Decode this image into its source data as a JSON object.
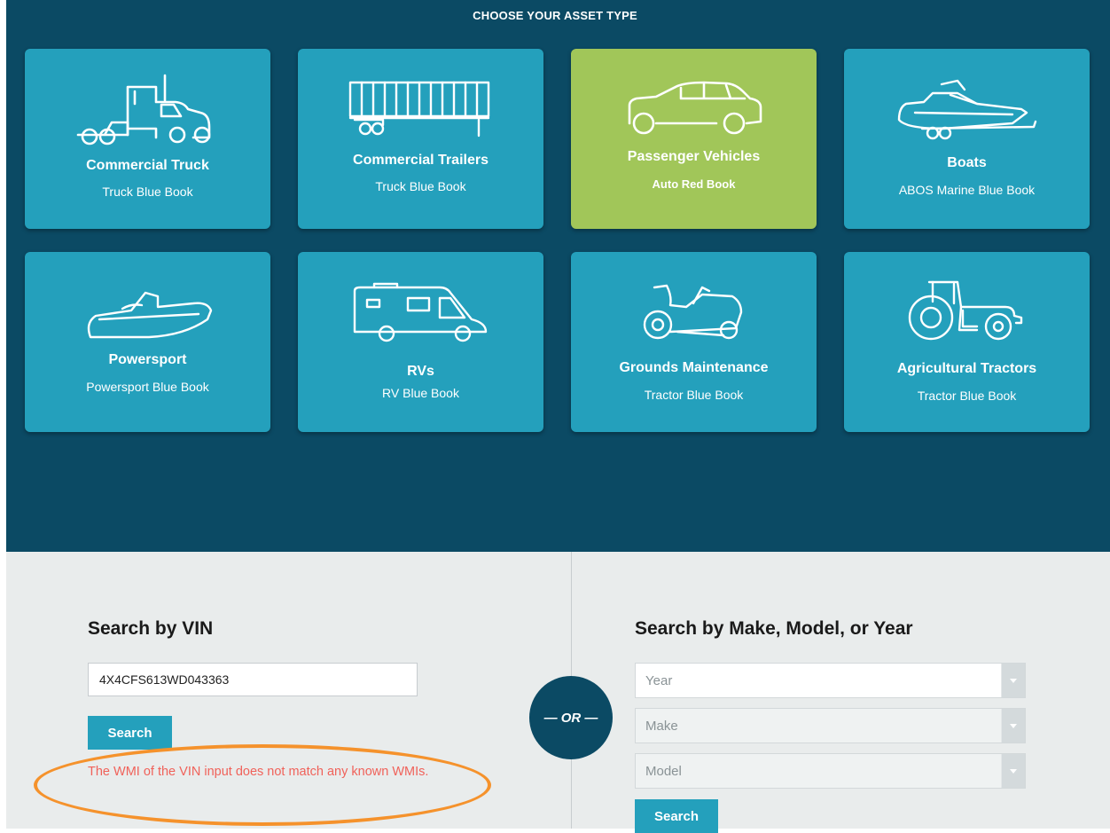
{
  "hero": {
    "title": "CHOOSE YOUR ASSET TYPE"
  },
  "tiles": [
    {
      "title": "Commercial Truck",
      "subtitle": "Truck Blue Book",
      "icon": "truck-icon",
      "selected": false
    },
    {
      "title": "Commercial Trailers",
      "subtitle": "Truck Blue Book",
      "icon": "trailer-icon",
      "selected": false
    },
    {
      "title": "Passenger Vehicles",
      "subtitle": "Auto Red Book",
      "icon": "car-icon",
      "selected": true
    },
    {
      "title": "Boats",
      "subtitle": "ABOS Marine Blue Book",
      "icon": "boat-icon",
      "selected": false
    },
    {
      "title": "Powersport",
      "subtitle": "Powersport Blue Book",
      "icon": "jetski-icon",
      "selected": false
    },
    {
      "title": "RVs",
      "subtitle": "RV Blue Book",
      "icon": "rv-icon",
      "selected": false
    },
    {
      "title": "Grounds Maintenance",
      "subtitle": "Tractor Blue Book",
      "icon": "riding-mower-icon",
      "selected": false
    },
    {
      "title": "Agricultural Tractors",
      "subtitle": "Tractor Blue Book",
      "icon": "tractor-icon",
      "selected": false
    }
  ],
  "vin_search": {
    "title": "Search by VIN",
    "input_value": "4X4CFS613WD043363",
    "button_label": "Search",
    "error": "The WMI of the VIN input does not match any known WMIs."
  },
  "divider_label": "— OR —",
  "mmy_search": {
    "title": "Search by Make, Model, or Year",
    "year_label": "Year",
    "make_label": "Make",
    "model_label": "Model",
    "button_label": "Search"
  },
  "colors": {
    "hero_bg": "#0b4a64",
    "tile": "#24a0bc",
    "tile_selected": "#a1c659",
    "error": "#f0625a",
    "annotation": "#f5922c"
  }
}
